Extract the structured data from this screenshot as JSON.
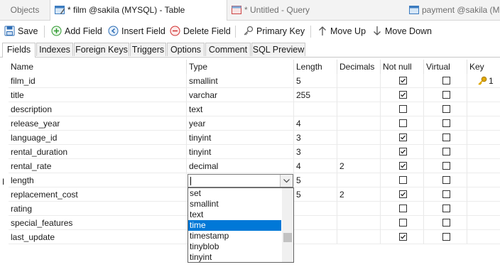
{
  "tabs": [
    {
      "label": "Objects"
    },
    {
      "label": "* film @sakila (MYSQL) - Table"
    },
    {
      "label": "* Untitled - Query"
    },
    {
      "label": "payment @sakila (MY"
    }
  ],
  "toolbar": {
    "save": "Save",
    "add_field": "Add Field",
    "insert_field": "Insert Field",
    "delete_field": "Delete Field",
    "primary_key": "Primary Key",
    "move_up": "Move Up",
    "move_down": "Move Down"
  },
  "subtabs": [
    "Fields",
    "Indexes",
    "Foreign Keys",
    "Triggers",
    "Options",
    "Comment",
    "SQL Preview"
  ],
  "columns": [
    "Name",
    "Type",
    "Length",
    "Decimals",
    "Not null",
    "Virtual",
    "Key"
  ],
  "rows": [
    {
      "name": "film_id",
      "type": "smallint",
      "length": "5",
      "decimals": "",
      "not_null": true,
      "virtual": false,
      "key": "1"
    },
    {
      "name": "title",
      "type": "varchar",
      "length": "255",
      "decimals": "",
      "not_null": true,
      "virtual": false,
      "key": ""
    },
    {
      "name": "description",
      "type": "text",
      "length": "",
      "decimals": "",
      "not_null": false,
      "virtual": false,
      "key": ""
    },
    {
      "name": "release_year",
      "type": "year",
      "length": "4",
      "decimals": "",
      "not_null": false,
      "virtual": false,
      "key": ""
    },
    {
      "name": "language_id",
      "type": "tinyint",
      "length": "3",
      "decimals": "",
      "not_null": true,
      "virtual": false,
      "key": ""
    },
    {
      "name": "rental_duration",
      "type": "tinyint",
      "length": "3",
      "decimals": "",
      "not_null": true,
      "virtual": false,
      "key": ""
    },
    {
      "name": "rental_rate",
      "type": "decimal",
      "length": "4",
      "decimals": "2",
      "not_null": true,
      "virtual": false,
      "key": ""
    },
    {
      "name": "length",
      "type": "",
      "length": "5",
      "decimals": "",
      "not_null": false,
      "virtual": false,
      "key": ""
    },
    {
      "name": "replacement_cost",
      "type": "",
      "length": "5",
      "decimals": "2",
      "not_null": true,
      "virtual": false,
      "key": ""
    },
    {
      "name": "rating",
      "type": "",
      "length": "",
      "decimals": "",
      "not_null": false,
      "virtual": false,
      "key": ""
    },
    {
      "name": "special_features",
      "type": "",
      "length": "",
      "decimals": "",
      "not_null": false,
      "virtual": false,
      "key": ""
    },
    {
      "name": "last_update",
      "type": "",
      "length": "",
      "decimals": "",
      "not_null": true,
      "virtual": false,
      "key": ""
    }
  ],
  "dropdown": {
    "value": "",
    "options": [
      "set",
      "smallint",
      "text",
      "time",
      "timestamp",
      "tinyblob",
      "tinyint"
    ],
    "selected": "time"
  },
  "colors": {
    "accent": "#0078d7",
    "key_icon": "#e0a800"
  }
}
